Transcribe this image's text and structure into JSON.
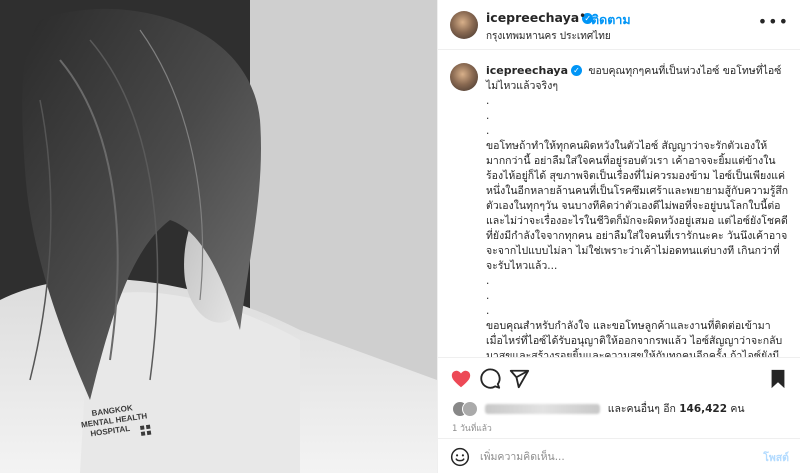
{
  "post": {
    "username": "icepreechaya",
    "verified_mark": "✓",
    "separator": "•",
    "follow_label": "ติดตาม",
    "location": "กรุงเทพมหานคร ประเทศไทย",
    "more_label": "•••"
  },
  "photo": {
    "gown_text_line1": "BANGKOK",
    "gown_text_line2": "MENTAL HEALTH",
    "gown_text_line3": "HOSPITAL"
  },
  "caption": {
    "username": "icepreechaya",
    "text": "ขอบคุณทุกๆคนที่เป็นห่วงไอซ์ ขอโทษที่ไอซ์ไม่ไหวแล้วจริงๆ\n.\n.\n.\nขอโทษถ้าทำให้ทุกคนผิดหวังในตัวไอซ์ สัญญาว่าจะรักตัวเองให้มากกว่านี้ อย่าลืมใส่ใจคนที่อยู่รอบตัวเรา เค้าอาจจะยิ้มแต่ข้างในร้องไห้อยู่ก็ได้ สุขภาพจิตเป็นเรื่องที่ไม่ควรมองข้าม ไอซ์เป็นเพียงแค่หนึ่งในอีกหลายล้านคนที่เป็นโรคซึมเศร้าและพยายามสู้กับความรู้สึกตัวเองในทุกๆวัน จนบางทีคิดว่าตัวเองดีไม่พอที่จะอยู่บนโลกใบนี้ต่อ และไม่ว่าจะเรื่องอะไรในชีวิตก็มักจะผิดหวังอยู่เสมอ แต่ไอซ์ยังโชคดีที่ยังมีกำลังใจจากทุกคน อย่าลืมใส่ใจคนที่เรารักนะคะ วันนึงเค้าอาจจะจากไปแบบไม่ลา ไม่ใช่เพราะว่าเค้าไม่อดทนแต่บางที เกินกว่าที่จะรับไหวแล้ว...\n.\n.\n.\nขอบคุณสำหรับกำลังใจ และขอโทษลูกค้าและงานที่ติดต่อเข้ามา เมื่อไหร่ที่ไอซ์ได้รับอนุญาติให้ออกจากรพแล้ว ไอซ์สัญญาว่าจะกลับมาสุขและสร้างรอยยิ้มและความสุขให้กับทุกคนอีกครั้ง ถ้าไอซ์ยังมีโอกาสนั้นนั้นอยู่จากทุกคน"
  },
  "actions": {
    "like_icon": "heart-icon",
    "comment_icon": "comment-icon",
    "share_icon": "share-icon",
    "save_icon": "bookmark-icon",
    "like_color": "#ed4956"
  },
  "likes": {
    "and_others": "และคนอื่นๆ อีก",
    "count": "146,422",
    "unit": "คน"
  },
  "timestamp": "1 วันที่แล้ว",
  "comment": {
    "placeholder": "เพิ่มความคิดเห็น...",
    "post_label": "โพสต์"
  }
}
